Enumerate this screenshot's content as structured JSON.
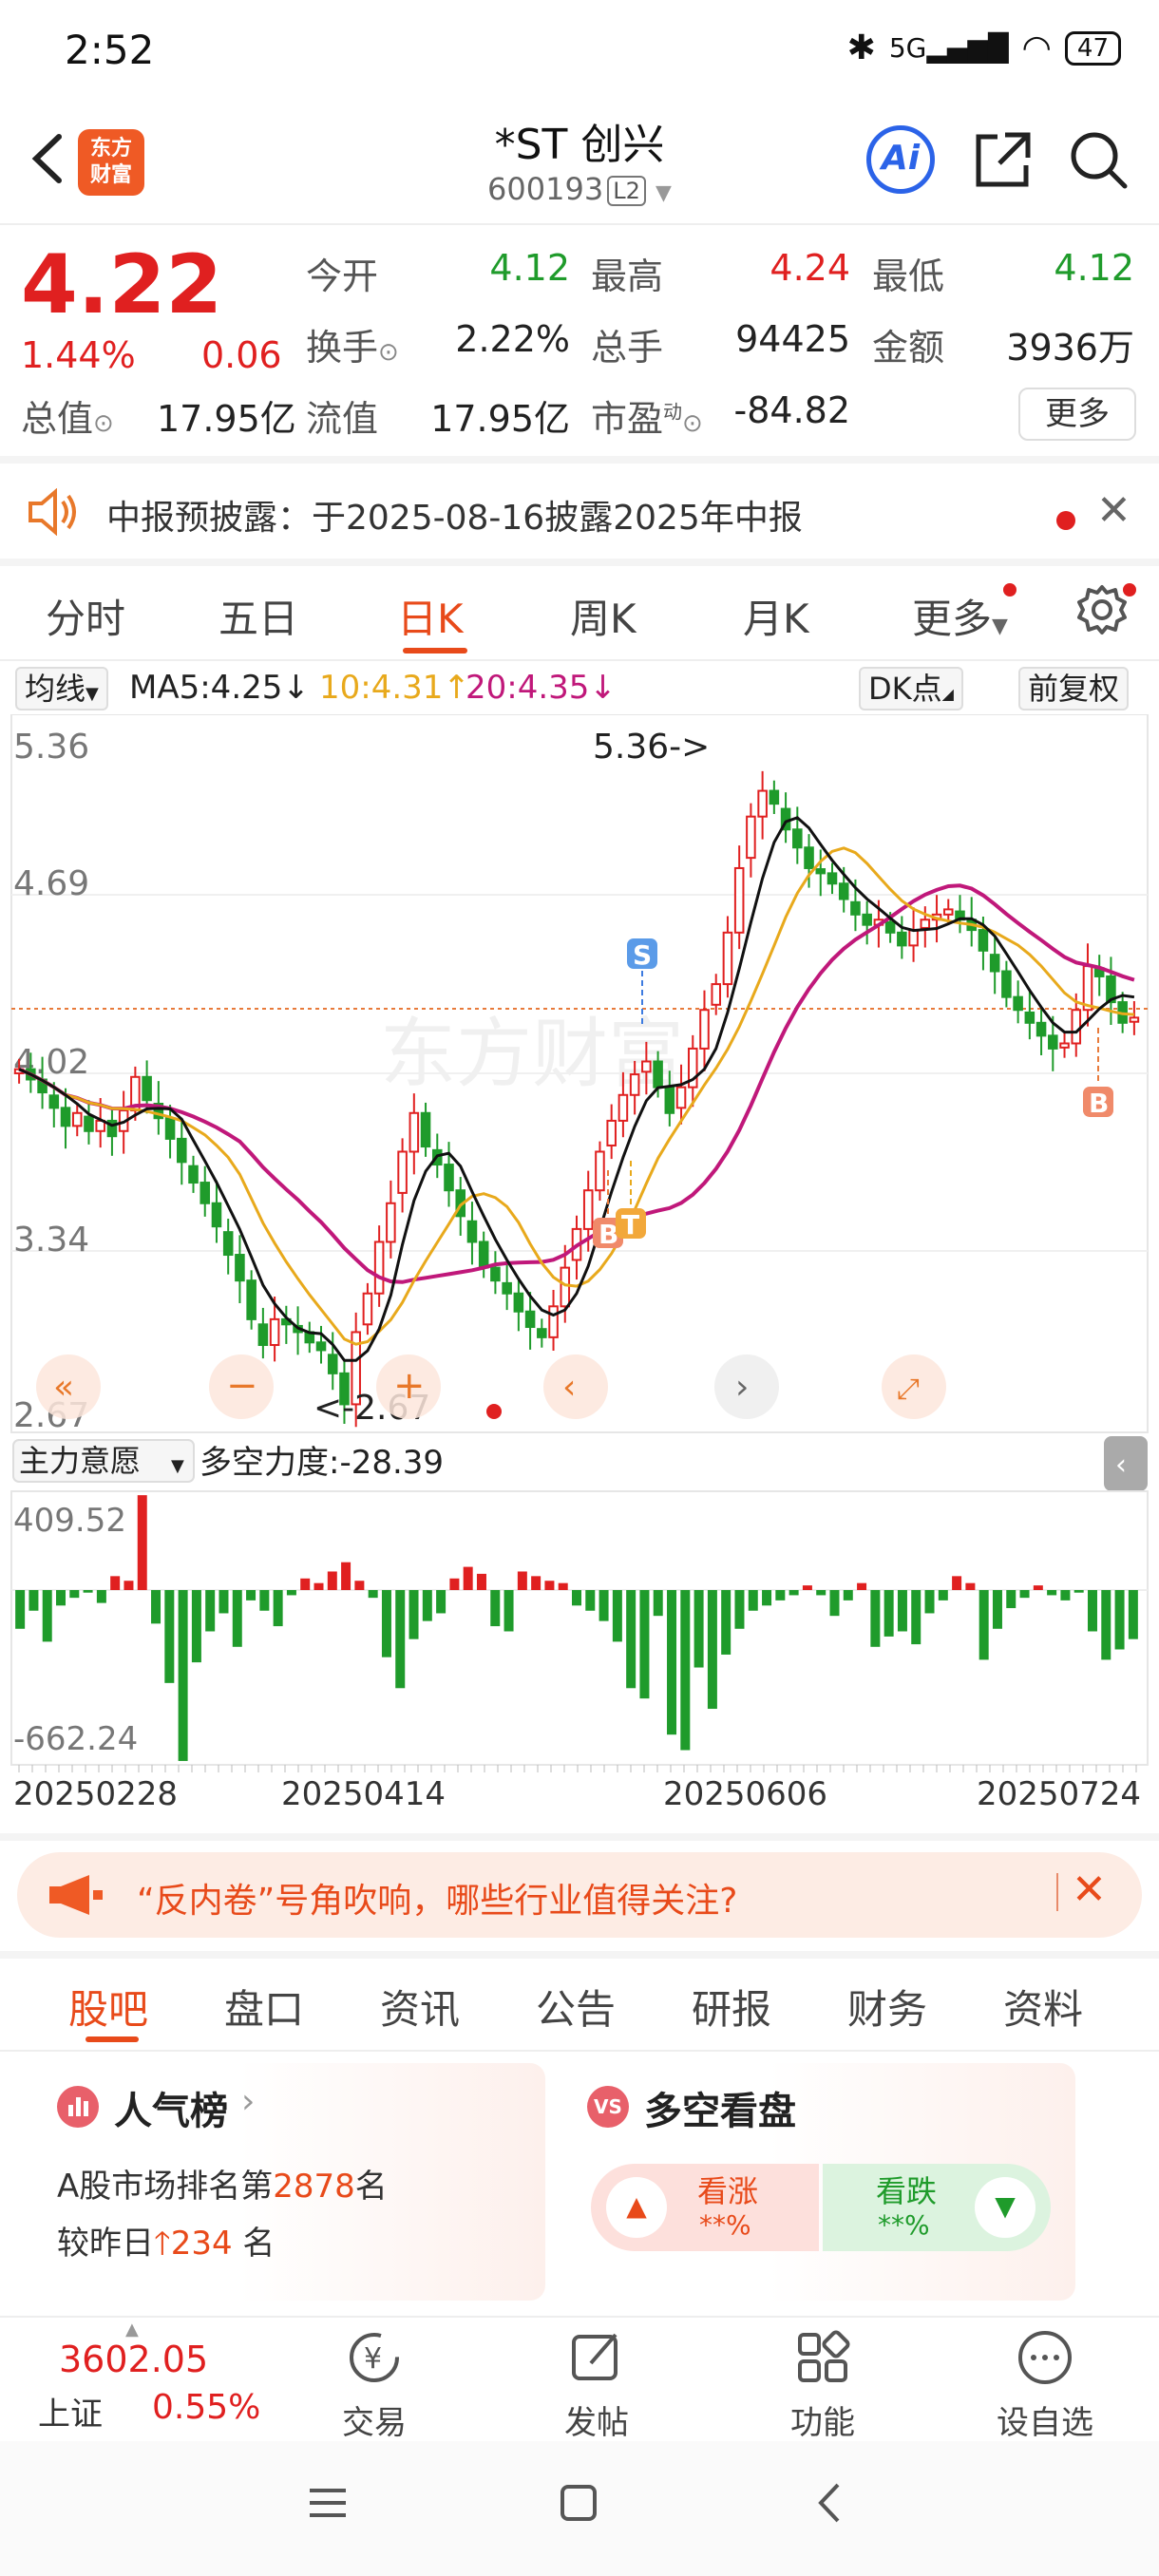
{
  "status": {
    "time": "2:52",
    "network": "5G",
    "battery": "47"
  },
  "header": {
    "name": "*ST 创兴",
    "code": "600193",
    "level": "L2",
    "logo_line1": "东方",
    "logo_line2": "财富"
  },
  "quote": {
    "price": "4.22",
    "change_pct": "1.44%",
    "change_val": "0.06",
    "mktcap_label": "总值",
    "mktcap": "17.95亿",
    "open_label": "今开",
    "open": "4.12",
    "high_label": "最高",
    "high": "4.24",
    "low_label": "最低",
    "low": "4.12",
    "turnover_label": "换手",
    "turnover": "2.22%",
    "volume_label": "总手",
    "volume": "94425",
    "amount_label": "金额",
    "amount": "3936万",
    "float_label": "流值",
    "float": "17.95亿",
    "pe_label": "市盈",
    "pe_sup": "动",
    "pe": "-84.82",
    "more": "更多"
  },
  "notice": {
    "text": "中报预披露：于2025-08-16披露2025年中报"
  },
  "chart_tabs": [
    "分时",
    "五日",
    "日K",
    "周K",
    "月K",
    "更多"
  ],
  "toolbar": {
    "indicator": "均线",
    "ma5": "MA5:4.25",
    "ma10": "10:4.31",
    "ma20": "20:4.35",
    "dk": "DK点",
    "adjust": "前复权"
  },
  "chart_labels": {
    "high_mark": "5.36->",
    "low_mark": "<-2.67",
    "sub_indicator": "主力意愿",
    "sub_value": "多空力度:-28.39"
  },
  "ad_banner": {
    "text": "“反内卷”号角吹响，哪些行业值得关注?"
  },
  "bottom_tabs": [
    "股吧",
    "盘口",
    "资讯",
    "公告",
    "研报",
    "财务",
    "资料"
  ],
  "popularity": {
    "title": "人气榜",
    "line1_prefix": "A股市场排名第",
    "rank": "2878",
    "line1_suffix": "名",
    "line2_prefix": "较昨日",
    "delta": "234",
    "line2_suffix": " 名"
  },
  "sentiment": {
    "title": "多空看盘",
    "bull": "看涨",
    "bull_pct": "**%",
    "bear": "看跌",
    "bear_pct": "**%"
  },
  "bottom_nav": {
    "index_value": "3602.05",
    "index_name": "上证",
    "index_pct": "0.55%",
    "trade": "交易",
    "post": "发帖",
    "function": "功能",
    "watch": "设自选"
  },
  "chart_data": {
    "type": "candlestick",
    "y_ticks": [
      "5.36",
      "4.69",
      "4.02",
      "3.34",
      "2.67"
    ],
    "ylim": [
      2.67,
      5.36
    ],
    "x_ticks": [
      "20250228",
      "20250414",
      "20250606",
      "20250724"
    ],
    "last_close": 4.22,
    "signals": [
      "S",
      "B",
      "T",
      "B"
    ],
    "sub_ticks": [
      "409.52",
      "-662.24"
    ],
    "closes": [
      4.02,
      3.98,
      3.93,
      3.87,
      3.8,
      3.85,
      3.78,
      3.82,
      3.76,
      3.86,
      3.99,
      3.9,
      3.83,
      3.75,
      3.66,
      3.58,
      3.5,
      3.41,
      3.3,
      3.2,
      3.05,
      2.95,
      3.05,
      3.03,
      3.0,
      2.96,
      2.93,
      2.84,
      2.72,
      3.0,
      3.15,
      3.35,
      3.5,
      3.7,
      3.85,
      3.72,
      3.65,
      3.55,
      3.45,
      3.35,
      3.25,
      3.2,
      3.15,
      3.08,
      3.02,
      2.98,
      3.1,
      3.25,
      3.4,
      3.55,
      3.7,
      3.82,
      3.92,
      4.0,
      4.05,
      3.95,
      3.85,
      3.95,
      4.1,
      4.25,
      4.35,
      4.55,
      4.8,
      5.0,
      5.1,
      5.05,
      4.95,
      4.88,
      4.8,
      4.78,
      4.74,
      4.68,
      4.62,
      4.58,
      4.6,
      4.55,
      4.5,
      4.56,
      4.6,
      4.62,
      4.64,
      4.6,
      4.56,
      4.48,
      4.4,
      4.3,
      4.25,
      4.2,
      4.15,
      4.1,
      4.12,
      4.25,
      4.42,
      4.38,
      4.28,
      4.2,
      4.22
    ],
    "sub_values": [
      -150,
      -80,
      -200,
      -60,
      -30,
      -10,
      -50,
      60,
      40,
      409,
      -130,
      -360,
      -662,
      -280,
      -160,
      -90,
      -220,
      -40,
      -80,
      -140,
      -20,
      50,
      30,
      80,
      120,
      40,
      -30,
      -260,
      -380,
      -190,
      -120,
      -90,
      50,
      100,
      70,
      -140,
      -160,
      80,
      60,
      40,
      30,
      -60,
      -80,
      -120,
      -200,
      -380,
      -420,
      -100,
      -560,
      -620,
      -300,
      -460,
      -250,
      -150,
      -80,
      -60,
      -40,
      -20,
      20,
      -20,
      -100,
      -40,
      30,
      -220,
      -180,
      -160,
      -210,
      -90,
      -40,
      60,
      30,
      -270,
      -150,
      -70,
      -30,
      20,
      -20,
      -40,
      -10,
      -160,
      -270,
      -230,
      -190
    ],
    "ma_series": [
      {
        "name": "MA5"
      },
      {
        "name": "10"
      },
      {
        "name": "20"
      }
    ]
  }
}
